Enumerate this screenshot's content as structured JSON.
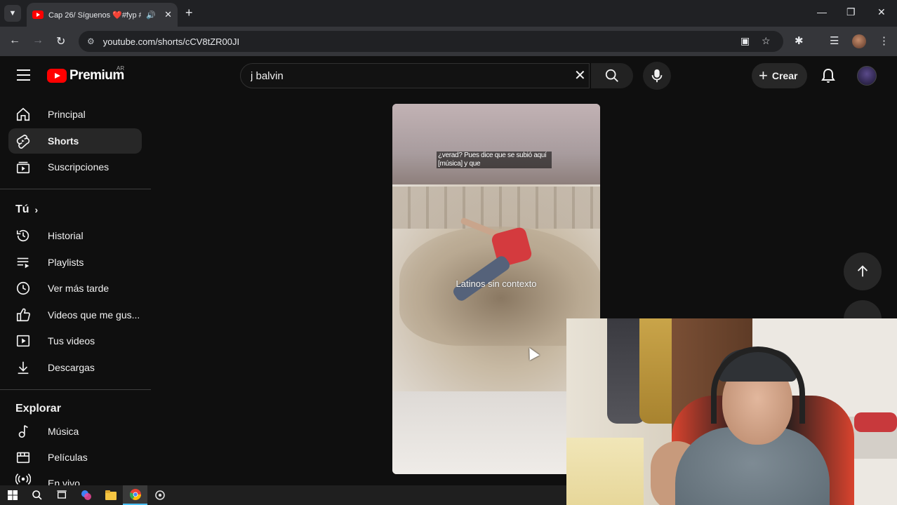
{
  "browser": {
    "tab_title": "Cap 26/ Síguenos ❤️#fyp #",
    "new_tab": "+",
    "url": "youtube.com/shorts/cCV8tZR00JI"
  },
  "header": {
    "brand": "Premium",
    "region": "AR",
    "search_value": "j balvin",
    "create_label": "Crear"
  },
  "sidebar": {
    "main": [
      {
        "label": "Principal",
        "icon": "home-icon"
      },
      {
        "label": "Shorts",
        "icon": "shorts-icon"
      },
      {
        "label": "Suscripciones",
        "icon": "subscriptions-icon"
      }
    ],
    "you_heading": "Tú",
    "you": [
      {
        "label": "Historial",
        "icon": "history-icon"
      },
      {
        "label": "Playlists",
        "icon": "playlists-icon"
      },
      {
        "label": "Ver más tarde",
        "icon": "watch-later-icon"
      },
      {
        "label": "Videos que me gus...",
        "icon": "liked-icon"
      },
      {
        "label": "Tus videos",
        "icon": "your-videos-icon"
      },
      {
        "label": "Descargas",
        "icon": "downloads-icon"
      }
    ],
    "explore_heading": "Explorar",
    "explore": [
      {
        "label": "Música",
        "icon": "music-icon"
      },
      {
        "label": "Películas",
        "icon": "movies-icon"
      },
      {
        "label": "En vivo",
        "icon": "live-icon"
      }
    ]
  },
  "short": {
    "caption": "¿verad? Pues dice que se subió aquí [música] y que",
    "watermark": "Latinos sin contexto"
  },
  "colors": {
    "background": "#0f0f0f",
    "accent": "#ff0000",
    "active_item": "#272727"
  }
}
